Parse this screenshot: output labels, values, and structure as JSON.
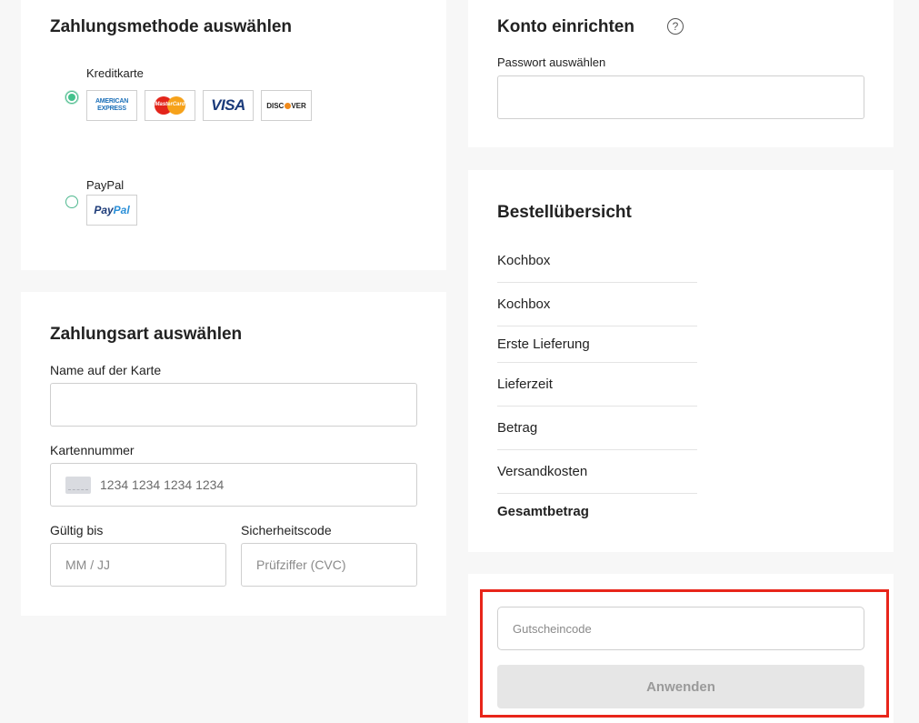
{
  "payment_method": {
    "title": "Zahlungsmethode auswählen",
    "options": [
      {
        "label": "Kreditkarte",
        "selected": true,
        "logos": [
          "amex-logo",
          "mastercard-logo",
          "visa-logo",
          "discover-logo"
        ]
      },
      {
        "label": "PayPal",
        "selected": false,
        "logos": [
          "paypal-logo"
        ]
      }
    ],
    "logo_text": {
      "amex_line1": "AMERICAN",
      "amex_line2": "EXPRESS",
      "mastercard": "MasterCard",
      "visa": "VISA",
      "discover_a": "DISC",
      "discover_b": "VER",
      "paypal_a": "Pay",
      "paypal_b": "Pal"
    }
  },
  "payment_type": {
    "title": "Zahlungsart auswählen",
    "name_label": "Name auf der Karte",
    "name_value": "",
    "card_number_label": "Kartennummer",
    "card_number_placeholder": "1234 1234 1234 1234",
    "expiry_label": "Gültig bis",
    "expiry_placeholder": "MM / JJ",
    "cvc_label": "Sicherheitscode",
    "cvc_placeholder": "Prüfziffer (CVC)"
  },
  "account": {
    "title": "Konto einrichten",
    "help_glyph": "?",
    "password_label": "Passwort auswählen",
    "password_value": ""
  },
  "summary": {
    "title": "Bestellübersicht",
    "rows": [
      "Kochbox",
      "Kochbox",
      "Erste Lieferung",
      "Lieferzeit",
      "Betrag",
      "Versandkosten"
    ],
    "total_label": "Gesamtbetrag"
  },
  "voucher": {
    "placeholder": "Gutscheincode",
    "apply_label": "Anwenden",
    "highlight_color": "#e8251a"
  },
  "colors": {
    "radio_accent": "#43c28c",
    "paypal_dark": "#1d3b78",
    "paypal_light": "#2a8fd8",
    "mastercard_red": "#e3251b",
    "mastercard_yellow": "#f6a21b",
    "discover_orange": "#f08a1b"
  }
}
